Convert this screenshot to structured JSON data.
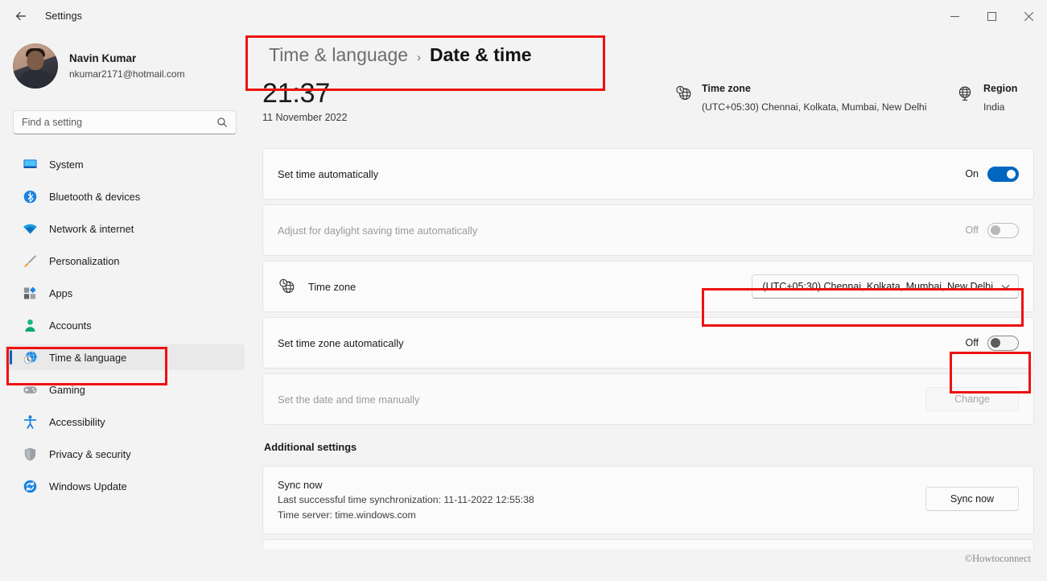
{
  "window": {
    "title": "Settings",
    "back_label": "Back",
    "minimize_label": "Minimize",
    "maximize_label": "Maximize",
    "close_label": "Close"
  },
  "profile": {
    "name": "Navin Kumar",
    "email": "nkumar2171@hotmail.com"
  },
  "search": {
    "placeholder": "Find a setting",
    "value": ""
  },
  "sidebar": {
    "items": [
      {
        "label": "System",
        "icon": "monitor-icon",
        "selected": false
      },
      {
        "label": "Bluetooth & devices",
        "icon": "bluetooth-icon",
        "selected": false
      },
      {
        "label": "Network & internet",
        "icon": "wifi-icon",
        "selected": false
      },
      {
        "label": "Personalization",
        "icon": "paintbrush-icon",
        "selected": false
      },
      {
        "label": "Apps",
        "icon": "apps-icon",
        "selected": false
      },
      {
        "label": "Accounts",
        "icon": "person-icon",
        "selected": false
      },
      {
        "label": "Time & language",
        "icon": "clock-globe-icon",
        "selected": true
      },
      {
        "label": "Gaming",
        "icon": "gamepad-icon",
        "selected": false
      },
      {
        "label": "Accessibility",
        "icon": "accessibility-icon",
        "selected": false
      },
      {
        "label": "Privacy & security",
        "icon": "shield-icon",
        "selected": false
      },
      {
        "label": "Windows Update",
        "icon": "update-icon",
        "selected": false
      }
    ]
  },
  "breadcrumb": {
    "parent": "Time & language",
    "separator": "›",
    "current": "Date & time"
  },
  "clock": {
    "time": "21:37",
    "date": "11 November 2022"
  },
  "summary": {
    "timezone": {
      "icon": "clock-globe-icon",
      "title": "Time zone",
      "value": "(UTC+05:30) Chennai, Kolkata, Mumbai, New Delhi"
    },
    "region": {
      "icon": "globe-icon",
      "title": "Region",
      "value": "India"
    }
  },
  "settings": {
    "set_time_automatically": {
      "label": "Set time automatically",
      "state_label": "On",
      "state": "on",
      "disabled": false
    },
    "adjust_dst_automatically": {
      "label": "Adjust for daylight saving time automatically",
      "state_label": "Off",
      "state": "off",
      "disabled": true
    },
    "time_zone": {
      "icon": "clock-globe-icon",
      "label": "Time zone",
      "selected_option": "(UTC+05:30) Chennai, Kolkata, Mumbai, New Delhi"
    },
    "set_time_zone_automatically": {
      "label": "Set time zone automatically",
      "state_label": "Off",
      "state": "off",
      "disabled": false
    },
    "set_date_time_manually": {
      "label": "Set the date and time manually",
      "button_label": "Change",
      "disabled": true
    }
  },
  "additional": {
    "section_title": "Additional settings",
    "sync": {
      "title": "Sync now",
      "last_sync": "Last successful time synchronization: 11-11-2022 12:55:38",
      "time_server": "Time server: time.windows.com",
      "button_label": "Sync now"
    }
  },
  "watermark": "©Howtoconnect",
  "colors": {
    "accent": "#0067C0",
    "annotation": "#EE1111",
    "page_bg": "#F3F3F3",
    "card_bg": "#FBFBFB"
  }
}
